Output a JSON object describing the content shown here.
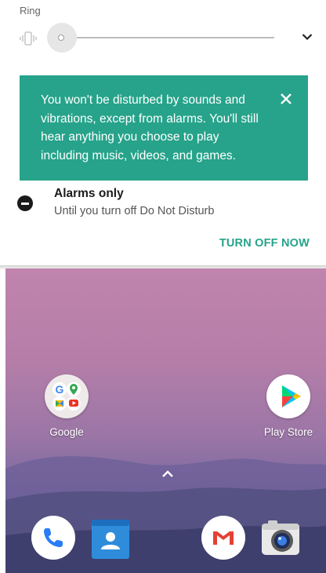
{
  "volume_panel": {
    "ring_label": "Ring",
    "ring_level": 0,
    "icons": {
      "mode": "vibrate-icon",
      "expand": "chevron-down-icon"
    }
  },
  "dnd": {
    "message": "You won't be disturbed by sounds and vibrations, except from alarms. You'll still hear anything you choose to play including music, videos, and games.",
    "close_icon": "close-icon",
    "card_color": "#26a38a",
    "mode_title": "Alarms only",
    "mode_subtitle": "Until you turn off Do Not Disturb",
    "turn_off_label": "TURN OFF NOW"
  },
  "home": {
    "apps": [
      {
        "label": "Google",
        "icon": "google-folder-icon"
      },
      {
        "label": "Play Store",
        "icon": "play-store-icon"
      }
    ],
    "app_drawer_icon": "chevron-up-icon",
    "dock": [
      {
        "icon": "phone-icon"
      },
      {
        "icon": "contacts-icon"
      },
      {
        "icon": "gmail-icon"
      },
      {
        "icon": "camera-icon"
      }
    ]
  }
}
